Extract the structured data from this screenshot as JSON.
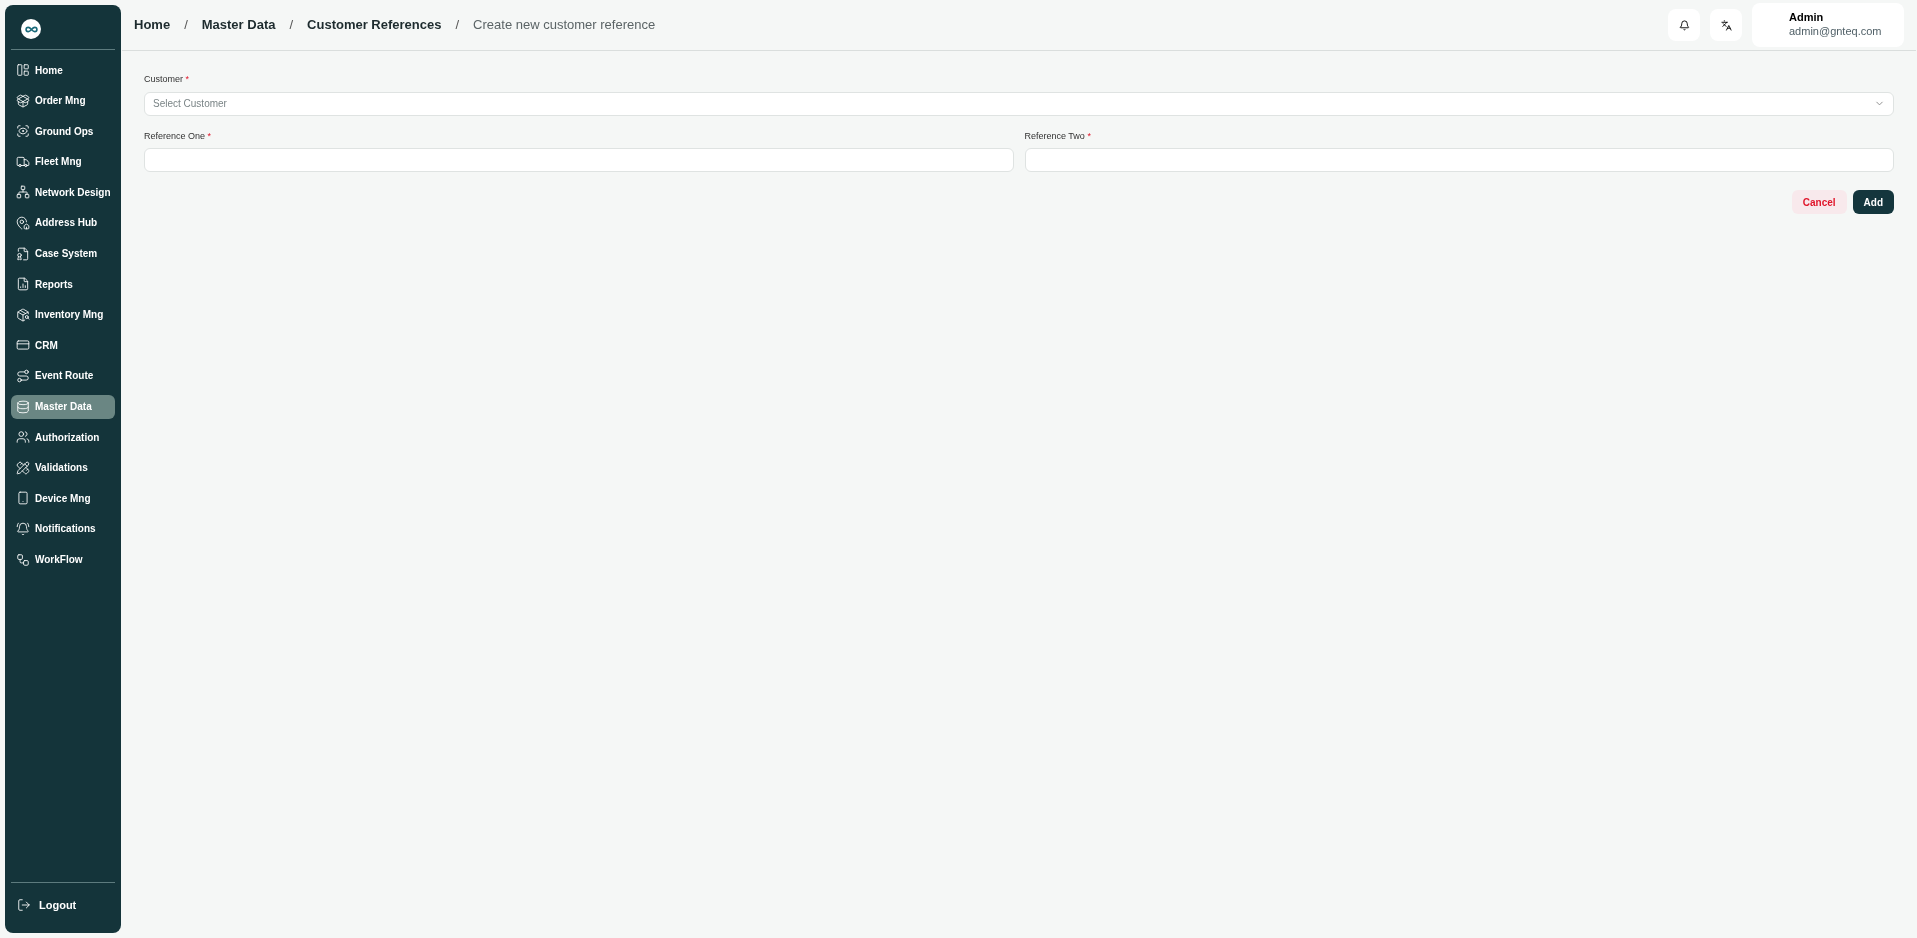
{
  "sidebar": {
    "items": [
      {
        "label": "Home",
        "selected": false
      },
      {
        "label": "Order Mng",
        "selected": false
      },
      {
        "label": "Ground Ops",
        "selected": false
      },
      {
        "label": "Fleet Mng",
        "selected": false
      },
      {
        "label": "Network Design",
        "selected": false
      },
      {
        "label": "Address Hub",
        "selected": false
      },
      {
        "label": "Case System",
        "selected": false
      },
      {
        "label": "Reports",
        "selected": false
      },
      {
        "label": "Inventory Mng",
        "selected": false
      },
      {
        "label": "CRM",
        "selected": false
      },
      {
        "label": "Event Route",
        "selected": false
      },
      {
        "label": "Master Data",
        "selected": true
      },
      {
        "label": "Authorization",
        "selected": false
      },
      {
        "label": "Validations",
        "selected": false
      },
      {
        "label": "Device Mng",
        "selected": false
      },
      {
        "label": "Notifications",
        "selected": false
      },
      {
        "label": "WorkFlow",
        "selected": false
      }
    ],
    "logout": "Logout"
  },
  "breadcrumb": [
    {
      "label": "Home",
      "current": false
    },
    {
      "label": "Master Data",
      "current": false
    },
    {
      "label": "Customer References",
      "current": false
    },
    {
      "label": "Create new customer reference",
      "current": true
    }
  ],
  "breadcrumb_separator": "/",
  "user": {
    "name": "Admin",
    "email": "admin@gnteq.com"
  },
  "form": {
    "customer": {
      "label": "Customer",
      "required_mark": "*",
      "placeholder": "Select Customer"
    },
    "fields": [
      {
        "label": "Reference One",
        "required_mark": "*"
      },
      {
        "label": "Reference Two",
        "required_mark": "*"
      }
    ],
    "buttons": [
      {
        "label": "Cancel",
        "kind": "secondary"
      },
      {
        "label": "Add",
        "kind": "primary"
      }
    ]
  }
}
